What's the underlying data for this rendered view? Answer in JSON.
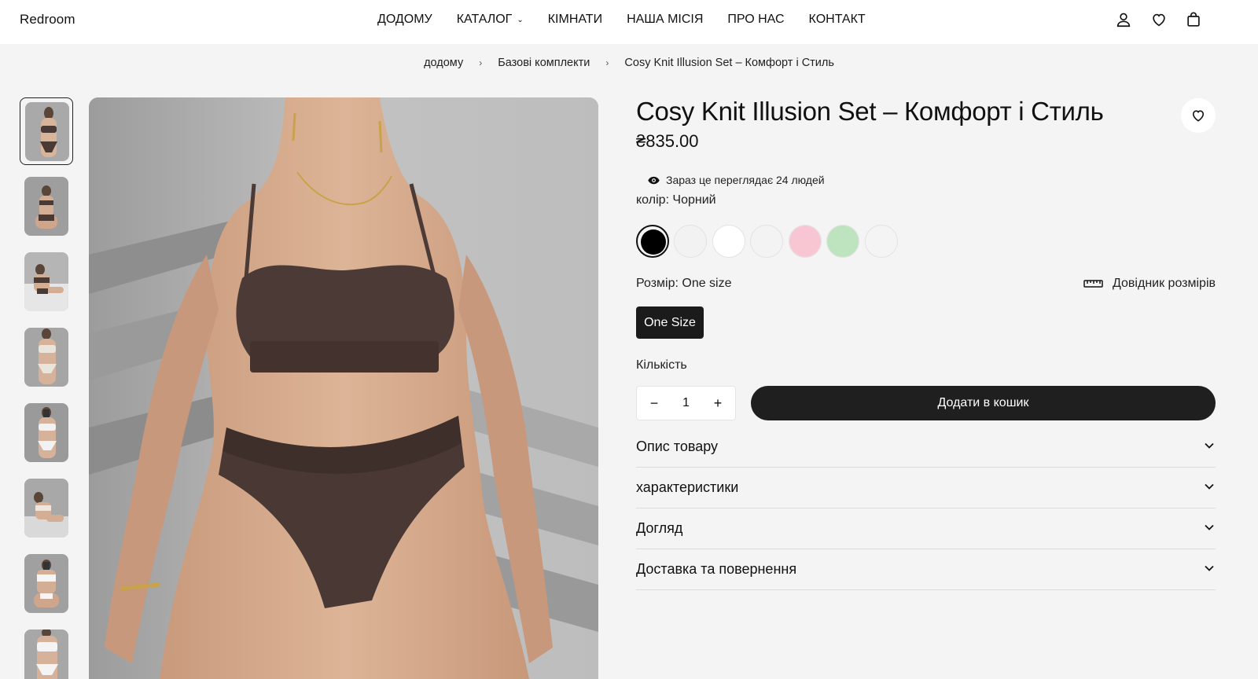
{
  "header": {
    "logo": "Redroom",
    "nav": [
      "ДОДОМУ",
      "КАТАЛОГ",
      "КІМНАТИ",
      "НАША МІСІЯ",
      "ПРО НАС",
      "КОНТАКТ"
    ],
    "icons": [
      "user-icon",
      "heart-icon",
      "bag-icon"
    ]
  },
  "breadcrumb": [
    "додому",
    "Базові комплекти",
    "Cosy Knit Illusion Set – Комфорт і Стиль"
  ],
  "product": {
    "title": "Cosy Knit Illusion Set – Комфорт і Стиль",
    "price": "₴835.00",
    "viewers": "Зараз це переглядає 24 людей",
    "color_label": "колір: Чорний",
    "swatches": [
      {
        "name": "black",
        "color": "#000000",
        "selected": true
      },
      {
        "name": "light-grey",
        "color": "#f2f2f2",
        "selected": false
      },
      {
        "name": "white",
        "color": "#ffffff",
        "selected": false
      },
      {
        "name": "off-white",
        "color": "#f3f3f3",
        "selected": false
      },
      {
        "name": "pink",
        "color": "#f8c6d3",
        "selected": false
      },
      {
        "name": "green",
        "color": "#bde3bf",
        "selected": false
      },
      {
        "name": "ivory",
        "color": "#f4f4f4",
        "selected": false
      }
    ],
    "size_label": "Розмір: One size",
    "size_guide": "Довідник розмірів",
    "size_option": "One Size",
    "qty_label": "Кількість",
    "qty_value": "1",
    "qty_minus": "−",
    "qty_plus": "+",
    "add_to_cart": "Додати в кошик",
    "accordions": [
      "Опис товару",
      "характеристики",
      "Догляд",
      "Доставка та повернення"
    ]
  },
  "colors": {
    "accent": "#1f1f1f",
    "background": "#f4f4f4",
    "header_bg": "#ffffff"
  }
}
